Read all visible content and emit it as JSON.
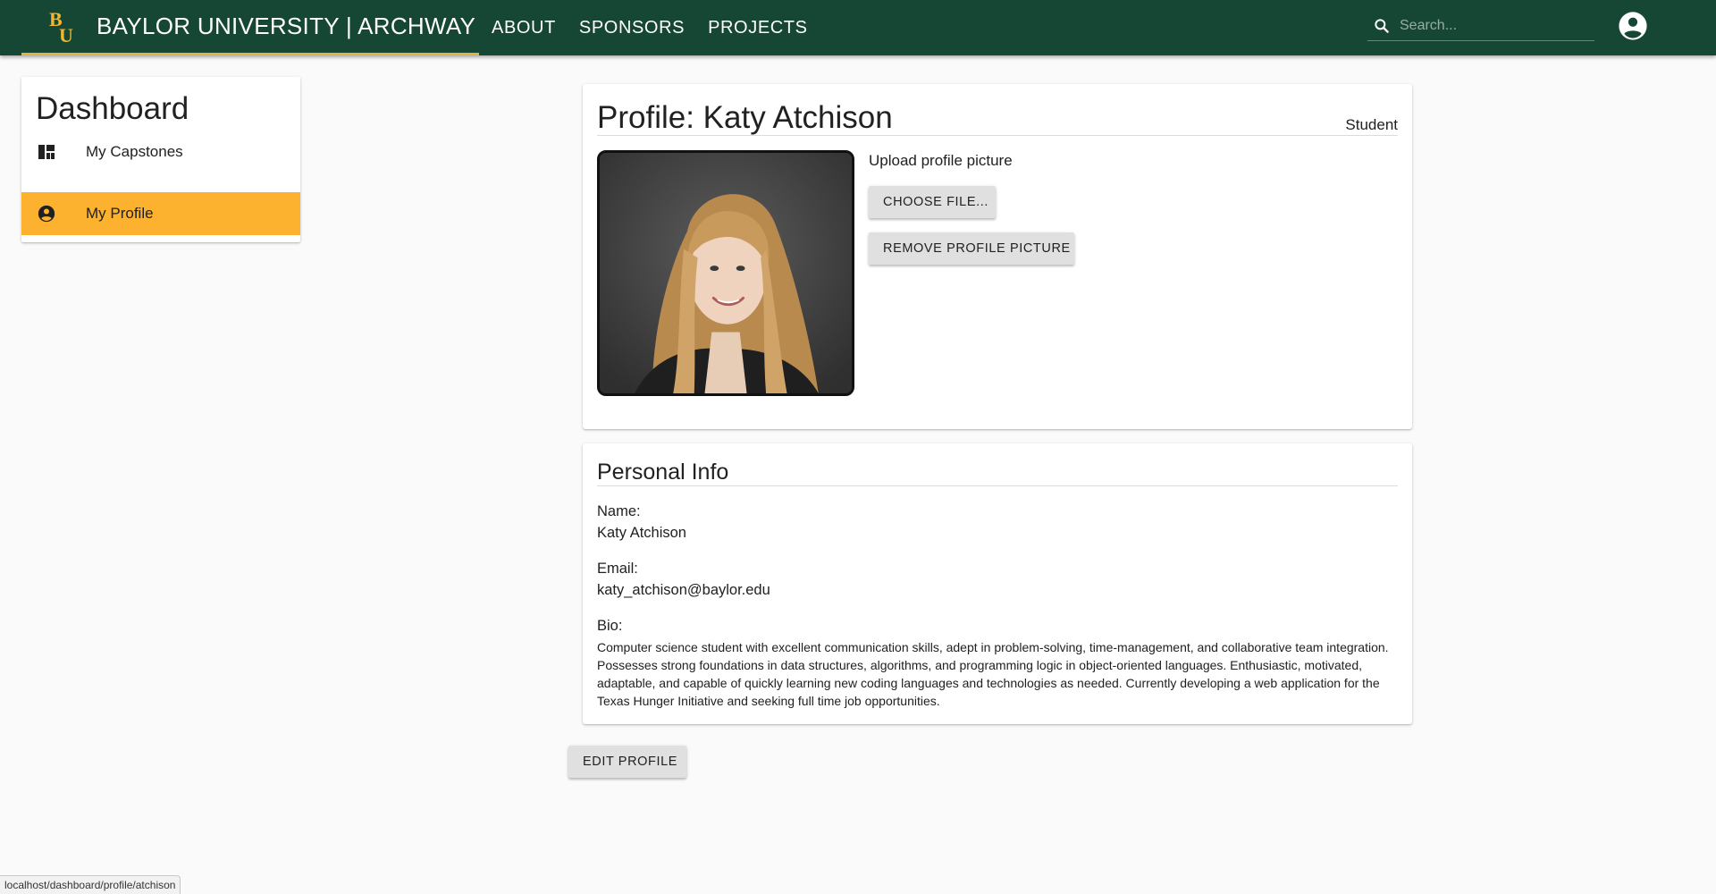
{
  "appbar": {
    "title": "BAYLOR UNIVERSITY | ARCHWAY",
    "logo": "BU",
    "nav": [
      "ABOUT",
      "SPONSORS",
      "PROJECTS"
    ],
    "search_placeholder": "Search...",
    "account_icon": "account-circle-icon",
    "colors": {
      "bar": "#154734",
      "accent": "#e0b23f"
    }
  },
  "sidebar": {
    "title": "Dashboard",
    "items": [
      {
        "label": "My Capstones",
        "icon": "dashboard-icon",
        "active": false
      },
      {
        "label": "My Profile",
        "icon": "account-circle-icon",
        "active": true
      }
    ],
    "active_color": "#fdb22f"
  },
  "profile": {
    "heading": "Profile: Katy Atchison",
    "role": "Student",
    "upload_label": "Upload profile picture",
    "choose_file": "CHOOSE FILE...",
    "remove_picture": "REMOVE PROFILE PICTURE"
  },
  "info": {
    "heading": "Personal Info",
    "name_label": "Name:",
    "name": "Katy Atchison",
    "email_label": "Email:",
    "email": "katy_atchison@baylor.edu",
    "bio_label": "Bio:",
    "bio": "Computer science student with excellent communication skills, adept in problem-solving, time-management, and collaborative team integration. Possesses strong foundations in data structures, algorithms, and programming logic in object-oriented languages. Enthusiastic, motivated, adaptable, and capable of quickly learning new coding languages and technologies as needed. Currently developing a web application for the Texas Hunger Initiative and seeking full time job opportunities."
  },
  "edit_profile": "EDIT PROFILE",
  "status_url": "localhost/dashboard/profile/atchison"
}
